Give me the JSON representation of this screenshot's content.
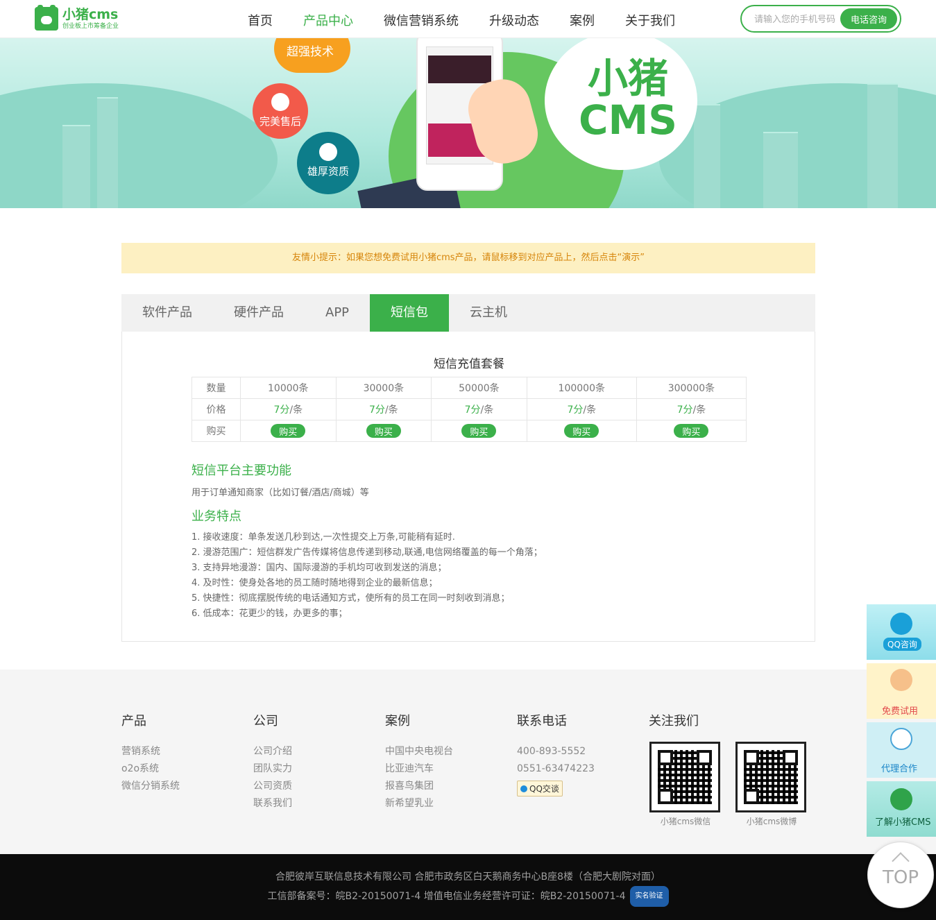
{
  "header": {
    "logo_name": "小猪cms",
    "logo_sub": "创业板上市筹备企业",
    "nav": [
      "首页",
      "产品中心",
      "微信营销系统",
      "升级动态",
      "案例",
      "关于我们"
    ],
    "phone_placeholder": "请输入您的手机号码",
    "phone_button": "电话咨询"
  },
  "banner": {
    "badges": [
      "超强技术",
      "完美售后",
      "雄厚资质"
    ],
    "cms_line1": "小猪",
    "cms_line2": "CMS"
  },
  "tip": "友情小提示：如果您想免费试用小猪cms产品，请鼠标移到对应产品上，然后点击“演示”",
  "tabs": [
    "软件产品",
    "硬件产品",
    "APP",
    "短信包",
    "云主机"
  ],
  "panel": {
    "title": "短信充值套餐",
    "row_labels": [
      "数量",
      "价格",
      "购买"
    ],
    "quantities": [
      "10000条",
      "30000条",
      "50000条",
      "100000条",
      "300000条"
    ],
    "price_value": "7分",
    "price_unit": "/条",
    "buy_label": "购买",
    "h_functions": "短信平台主要功能",
    "functions_desc": "用于订单通知商家（比如订餐/酒店/商城）等",
    "h_features": "业务特点",
    "features": [
      "1. 接收速度：单条发送几秒到达,一次性提交上万条,可能稍有延时.",
      "2. 漫游范围广：短信群发广告传媒将信息传递到移动,联通,电信网络覆盖的每一个角落；",
      "3. 支持异地漫游：国内、国际漫游的手机均可收到发送的消息；",
      "4. 及时性：使身处各地的员工随时随地得到企业的最新信息；",
      "5. 快捷性：彻底摆脱传统的电话通知方式，使所有的员工在同一时刻收到消息；",
      "6. 低成本：花更少的钱，办更多的事；"
    ]
  },
  "footer": {
    "products": {
      "title": "产品",
      "links": [
        "营销系统",
        "o2o系统",
        "微信分销系统"
      ]
    },
    "company": {
      "title": "公司",
      "links": [
        "公司介绍",
        "团队实力",
        "公司资质",
        "联系我们"
      ]
    },
    "cases": {
      "title": "案例",
      "links": [
        "中国中央电视台",
        "比亚迪汽车",
        "报喜鸟集团",
        "新希望乳业"
      ]
    },
    "contact": {
      "title": "联系电话",
      "phones": [
        "400-893-5552",
        "0551-63474223"
      ],
      "qq": "QQ交谈"
    },
    "follow": {
      "title": "关注我们",
      "captions": [
        "小猪cms微信",
        "小猪cms微博"
      ]
    },
    "address": "合肥彼岸互联信息技术有限公司  合肥市政务区白天鹅商务中心B座8楼（合肥大剧院对面）",
    "icp": "工信部备案号：皖B2-20150071-4  增值电信业务经营许可证：皖B2-20150071-4",
    "safe_badge": "实名验证"
  },
  "side": {
    "qq": "QQ咨询",
    "trial": "免费试用",
    "agent": "代理合作",
    "learn": "了解小猪CMS",
    "top": "TOP"
  },
  "colors": {
    "accent": "#3bb04a",
    "tip_bg": "#fdf0c2",
    "tip_text": "#d6850b",
    "footer_bg": "#f5f5f5",
    "bottom_bg": "#0c0c0c"
  }
}
